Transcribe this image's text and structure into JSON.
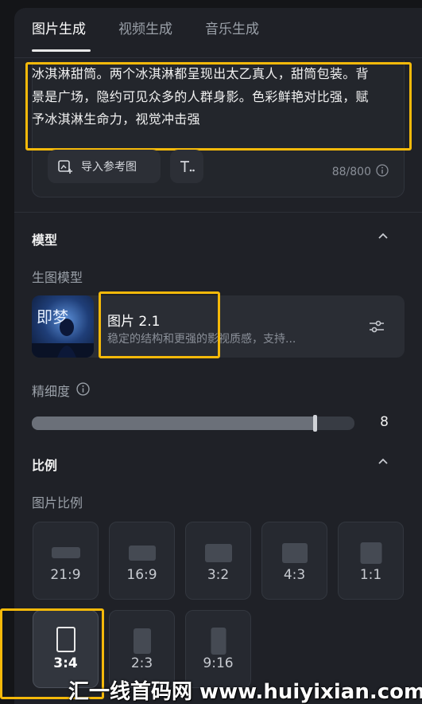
{
  "tabs": [
    {
      "label": "图片生成",
      "active": true
    },
    {
      "label": "视频生成",
      "active": false
    },
    {
      "label": "音乐生成",
      "active": false
    }
  ],
  "prompt": {
    "text": "冰淇淋甜筒。两个冰淇淋都呈现出太乙真人，甜筒包装。背景是广场，隐约可见众多的人群身影。色彩鲜艳对比强，赋予冰淇淋生命力，视觉冲击强",
    "import_ref_label": "导入参考图",
    "text_style_icon": "text-style-icon",
    "counter": "88/800",
    "info_icon": "info-icon"
  },
  "model_section": {
    "title": "模型",
    "sub_label": "生图模型",
    "model": {
      "name": "图片 2.1",
      "description": "稳定的结构和更强的影视质感，支持...",
      "thumb_text": "即梦"
    },
    "settings_icon": "sliders-icon"
  },
  "detail": {
    "label": "精细度",
    "info_icon": "info-icon",
    "value": 8,
    "fill_fraction": 0.8
  },
  "ratio_section": {
    "title": "比例",
    "sub_label": "图片比例",
    "options": [
      "21:9",
      "16:9",
      "3:2",
      "4:3",
      "1:1",
      "3:4",
      "2:3",
      "9:16"
    ],
    "selected": "3:4"
  },
  "colors": {
    "highlight": "#f5b90a",
    "panel": "#1f2127",
    "background": "#141518"
  },
  "watermark": "汇一线首码网 www.huiyixian.com"
}
